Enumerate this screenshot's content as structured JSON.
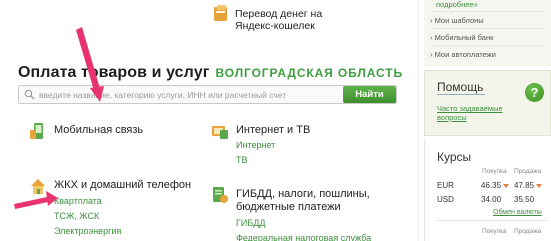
{
  "top_transfer": {
    "label": "Перевод денег на\nЯндекс-кошелек",
    "icon": "wallet-icon"
  },
  "heading": {
    "title": "Оплата товаров и услуг",
    "region": "ВОЛГОГРАДСКАЯ ОБЛАСТЬ"
  },
  "search": {
    "placeholder": "введите название, категорию услуги, ИНН или расчетный счет",
    "button": "Найти"
  },
  "categories": {
    "mobile": {
      "title": "Мобильная связь",
      "icon": "phone-icon"
    },
    "internet_tv": {
      "title": "Интернет и ТВ",
      "icon": "tv-icon",
      "links": [
        "Интернет",
        "ТВ"
      ]
    },
    "housing": {
      "title": "ЖКХ и домашний телефон",
      "icon": "house-icon",
      "links": [
        "Квартплата",
        "ТСЖ, ЖСК",
        "Электроэнергия"
      ]
    },
    "gibdd": {
      "title": "ГИБДД, налоги, пошлины,\nбюджетные платежи",
      "icon": "document-icon",
      "links": [
        "ГИБДД",
        "Федеральная налоговая служба"
      ]
    }
  },
  "sidebar": {
    "more": "подробнее»",
    "links": [
      "Мои шаблоны",
      "Мобильный банк",
      "Мои автоплатежи"
    ],
    "help": {
      "title": "Помощь",
      "link": "Часто задаваемые\nвопросы",
      "icon": "question-icon"
    },
    "rates": {
      "title": "Курсы",
      "headers": [
        "Покупка",
        "Продажа"
      ],
      "rows": [
        {
          "currency": "EUR",
          "buy": "46.35",
          "sell": "47.85"
        },
        {
          "currency": "USD",
          "buy": "34.00",
          "sell": "35.50"
        }
      ],
      "more": "Обмен валюты"
    }
  },
  "colors": {
    "accent_green": "#3d8f3d",
    "button_green": "#4ea23c",
    "annotation_arrow": "#e8336e"
  }
}
